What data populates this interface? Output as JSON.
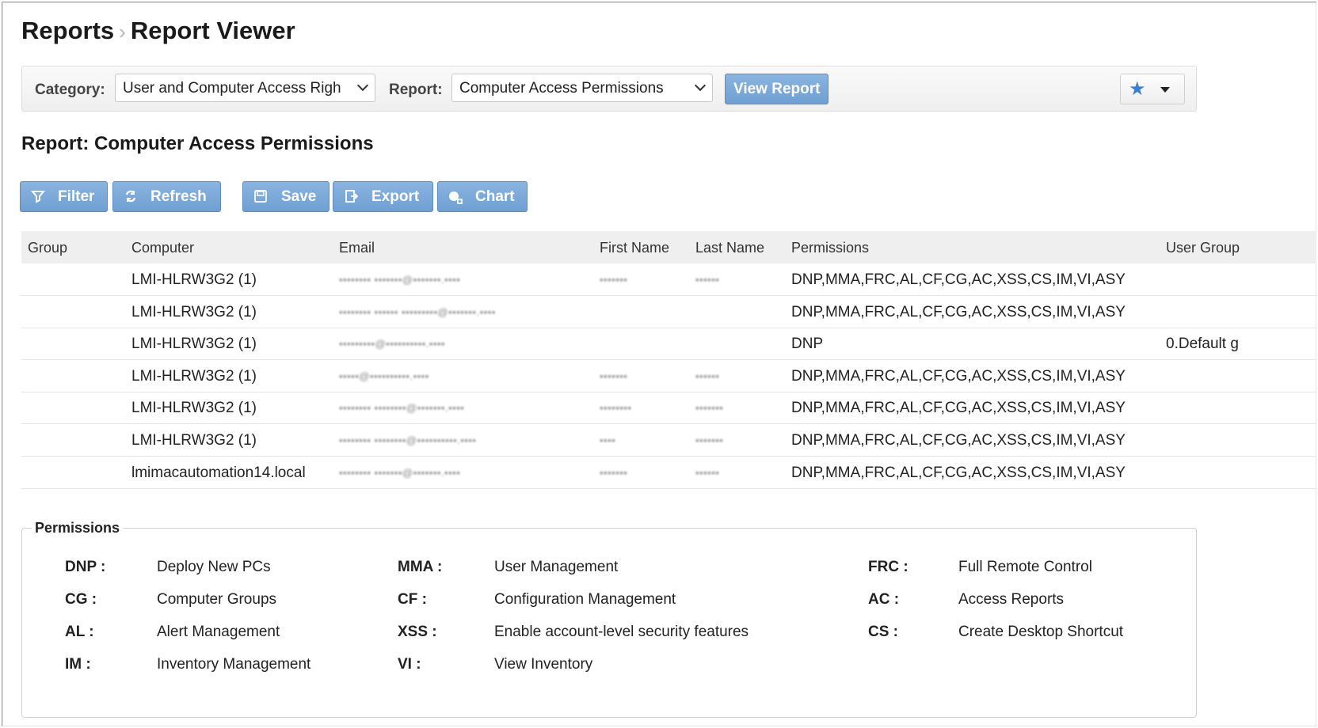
{
  "breadcrumb": {
    "parent": "Reports",
    "separator": "›",
    "current": "Report Viewer"
  },
  "toolbar": {
    "category_label": "Category:",
    "category_value": "User and Computer Access Righ",
    "report_label": "Report:",
    "report_value": "Computer Access Permissions",
    "view_button": "View Report"
  },
  "report_title": "Report: Computer Access Permissions",
  "actions": {
    "filter": "Filter",
    "refresh": "Refresh",
    "save": "Save",
    "export": "Export",
    "chart": "Chart"
  },
  "table": {
    "headers": [
      "Group",
      "Computer",
      "Email",
      "First Name",
      "Last Name",
      "Permissions",
      "User Group"
    ],
    "rows": [
      {
        "group": "",
        "computer": "LMI-HLRW3G2 (1)",
        "email": "••••••••  •••••••@•••••••.••••",
        "first": "•••••••",
        "last": "••••••",
        "permissions": "DNP,MMA,FRC,AL,CF,CG,AC,XSS,CS,IM,VI,ASY",
        "user_group": ""
      },
      {
        "group": "",
        "computer": "LMI-HLRW3G2 (1)",
        "email": "•••••••• •••••• •••••••••@•••••••.••••",
        "first": "",
        "last": "",
        "permissions": "DNP,MMA,FRC,AL,CF,CG,AC,XSS,CS,IM,VI,ASY",
        "user_group": ""
      },
      {
        "group": "",
        "computer": "LMI-HLRW3G2 (1)",
        "email": "•••••••••@••••••••••.••••",
        "first": "",
        "last": "",
        "permissions": "DNP",
        "user_group": "0.Default g"
      },
      {
        "group": "",
        "computer": "LMI-HLRW3G2 (1)",
        "email": "•••••@••••••••••.••••",
        "first": "•••••••",
        "last": "••••••",
        "permissions": "DNP,MMA,FRC,AL,CF,CG,AC,XSS,CS,IM,VI,ASY",
        "user_group": ""
      },
      {
        "group": "",
        "computer": "LMI-HLRW3G2 (1)",
        "email": "•••••••• ••••••••@•••••••.••••",
        "first": "••••••••",
        "last": "•••••••",
        "permissions": "DNP,MMA,FRC,AL,CF,CG,AC,XSS,CS,IM,VI,ASY",
        "user_group": ""
      },
      {
        "group": "",
        "computer": "LMI-HLRW3G2 (1)",
        "email": "•••••••• ••••••••@••••••••••.••••",
        "first": "••••",
        "last": "•••••••",
        "permissions": "DNP,MMA,FRC,AL,CF,CG,AC,XSS,CS,IM,VI,ASY",
        "user_group": ""
      },
      {
        "group": "",
        "computer": "lmimacautomation14.local",
        "email": "••••••••  •••••••@•••••••.••••",
        "first": "•••••••",
        "last": "••••••",
        "permissions": "DNP,MMA,FRC,AL,CF,CG,AC,XSS,CS,IM,VI,ASY",
        "user_group": ""
      }
    ]
  },
  "permissions_legend": {
    "title": "Permissions",
    "items": [
      {
        "code": "DNP :",
        "desc": "Deploy New PCs"
      },
      {
        "code": "MMA :",
        "desc": "User Management"
      },
      {
        "code": "FRC :",
        "desc": "Full Remote Control"
      },
      {
        "code": "CG :",
        "desc": "Computer Groups"
      },
      {
        "code": "CF :",
        "desc": "Configuration Management"
      },
      {
        "code": "AC :",
        "desc": "Access Reports"
      },
      {
        "code": "AL :",
        "desc": "Alert Management"
      },
      {
        "code": "XSS :",
        "desc": "Enable account-level security features"
      },
      {
        "code": "CS :",
        "desc": "Create Desktop Shortcut"
      },
      {
        "code": "IM :",
        "desc": "Inventory Management"
      },
      {
        "code": "VI :",
        "desc": "View Inventory"
      }
    ]
  },
  "colors": {
    "button_primary": "#7aa8da",
    "star": "#3d7fd1",
    "table_header_bg": "#efefef"
  },
  "icons": {
    "filter": "filter-icon",
    "refresh": "refresh-icon",
    "save": "save-icon",
    "export": "export-icon",
    "chart": "chart-add-icon",
    "favorite": "star-icon"
  }
}
